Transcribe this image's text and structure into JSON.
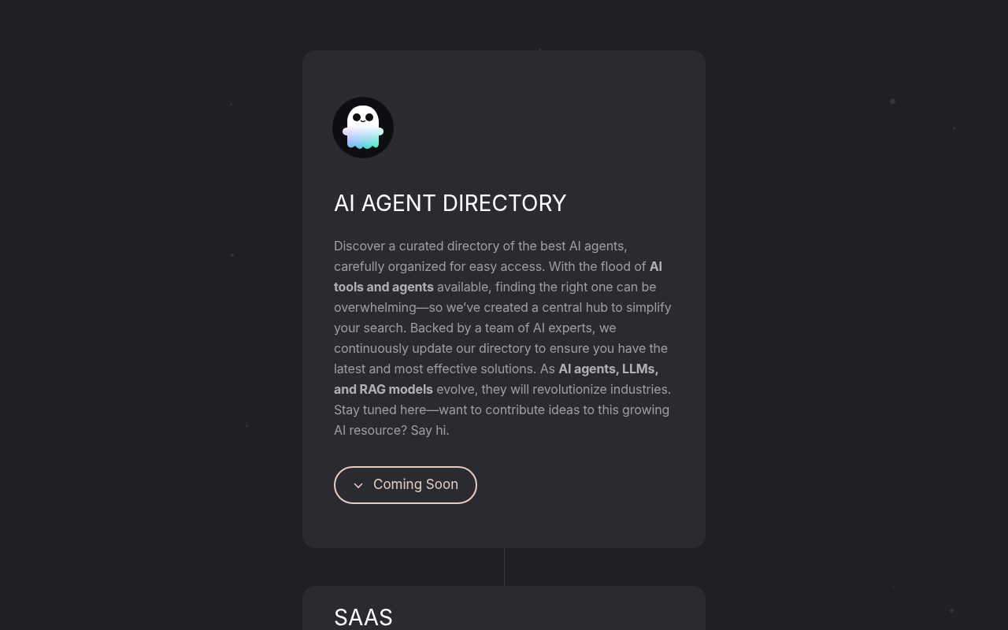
{
  "cards": [
    {
      "title": "AI AGENT DIRECTORY",
      "description": "Discover a curated directory of the best AI agents, carefully organized for easy access. With the flood of **AI tools and agents** available, finding the right one can be overwhelming—so we’ve created a central hub to simplify your search. Backed by a team of AI experts, we continuously update our directory to ensure you have the latest and most effective solutions. As **AI agents, LLMs, and RAG models** evolve, they will revolutionize industries. Stay tuned here—want to contribute ideas to this growing AI resource? Say hi.",
      "button": "Coming Soon",
      "logo": true
    },
    {
      "title": "SAAS",
      "logo": false
    }
  ]
}
